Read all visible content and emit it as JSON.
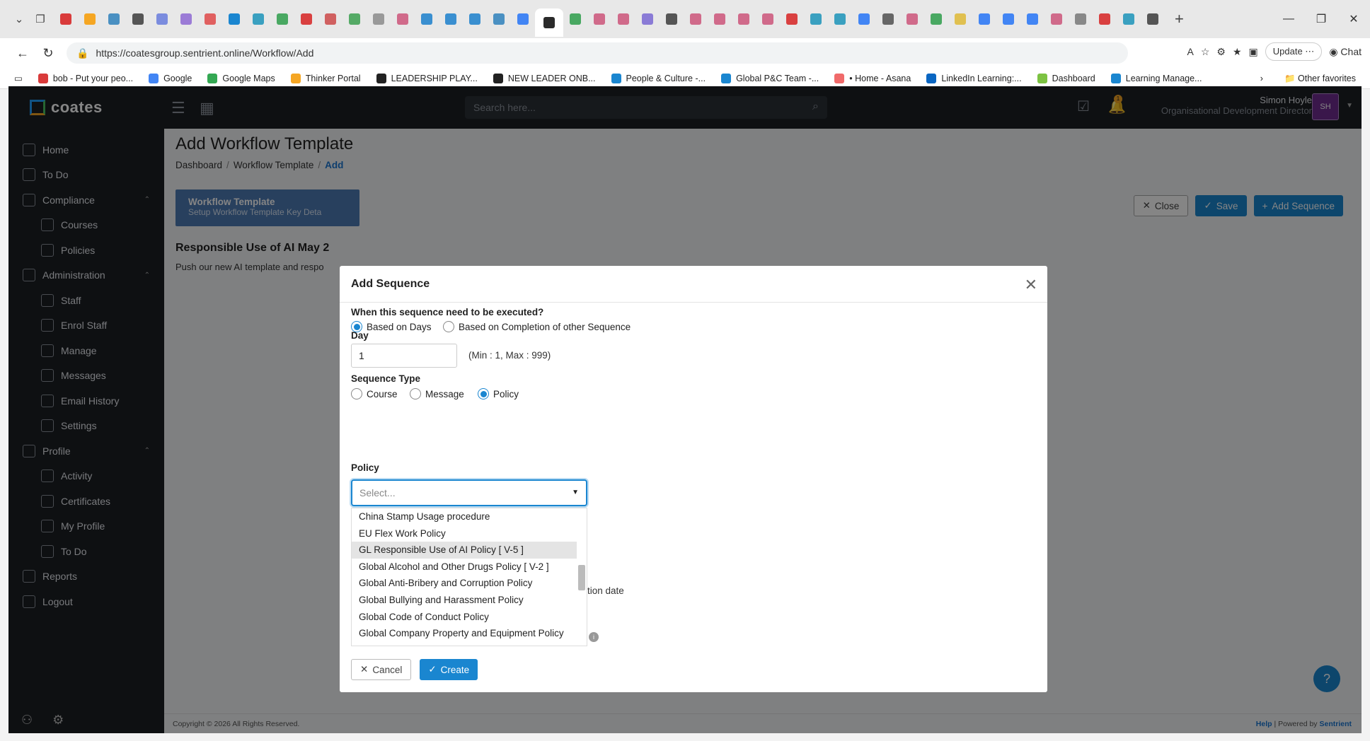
{
  "browser": {
    "url": "https://coatesgroup.sentrient.online/Workflow/Add",
    "update_label": "Update",
    "chat_label": "Chat",
    "bookmarks": [
      {
        "label": "bob - Put your peo...",
        "color": "#d93b3b"
      },
      {
        "label": "Google",
        "color": "#4285f4"
      },
      {
        "label": "Google Maps",
        "color": "#34a853"
      },
      {
        "label": "Thinker Portal",
        "color": "#f5a623"
      },
      {
        "label": "LEADERSHIP PLAY...",
        "color": "#222222"
      },
      {
        "label": "NEW LEADER ONB...",
        "color": "#222222"
      },
      {
        "label": "People & Culture -...",
        "color": "#1a86d0"
      },
      {
        "label": "Global P&C Team -...",
        "color": "#1a86d0"
      },
      {
        "label": "• Home - Asana",
        "color": "#f06a6a"
      },
      {
        "label": "LinkedIn Learning:...",
        "color": "#0a66c2"
      },
      {
        "label": "Dashboard",
        "color": "#7cc242"
      },
      {
        "label": "Learning Manage...",
        "color": "#1a86d0"
      }
    ],
    "other_favorites": "Other favorites"
  },
  "app": {
    "logo": "coates",
    "search_placeholder": "Search here...",
    "notif_count": "1",
    "user_name": "Simon Hoyle",
    "user_role": "Organisational Development Director",
    "user_initials": "SH"
  },
  "sidebar": {
    "items": [
      {
        "label": "Home",
        "type": "top"
      },
      {
        "label": "To Do",
        "type": "top"
      },
      {
        "label": "Compliance",
        "type": "group"
      },
      {
        "label": "Courses",
        "type": "sub"
      },
      {
        "label": "Policies",
        "type": "sub"
      },
      {
        "label": "Administration",
        "type": "group"
      },
      {
        "label": "Staff",
        "type": "sub"
      },
      {
        "label": "Enrol Staff",
        "type": "sub"
      },
      {
        "label": "Manage",
        "type": "sub"
      },
      {
        "label": "Messages",
        "type": "sub"
      },
      {
        "label": "Email History",
        "type": "sub"
      },
      {
        "label": "Settings",
        "type": "sub"
      },
      {
        "label": "Profile",
        "type": "group"
      },
      {
        "label": "Activity",
        "type": "sub"
      },
      {
        "label": "Certificates",
        "type": "sub"
      },
      {
        "label": "My Profile",
        "type": "sub"
      },
      {
        "label": "To Do",
        "type": "sub"
      },
      {
        "label": "Reports",
        "type": "top"
      },
      {
        "label": "Logout",
        "type": "top"
      }
    ]
  },
  "page": {
    "title": "Add Workflow Template",
    "breadcrumb": [
      "Dashboard",
      "Workflow Template",
      "Add"
    ],
    "card_title": "Workflow Template",
    "card_subtitle": "Setup Workflow Template Key Deta",
    "close_label": "Close",
    "save_label": "Save",
    "add_sequence_label": "Add Sequence",
    "template_name": "Responsible Use of AI May 2",
    "template_desc": "Push our new AI template and respo",
    "footer_left": "Copyright © 2026 All Rights Reserved.",
    "footer_help": "Help",
    "footer_powered": "Powered by",
    "footer_brand": "Sentrient"
  },
  "modal": {
    "title": "Add Sequence",
    "q_label": "When this sequence need to be executed?",
    "exec_options": [
      "Based on Days",
      "Based on Completion of other Sequence"
    ],
    "exec_selected": 0,
    "day_label": "Day",
    "day_value": "1",
    "day_hint": "(Min : 1, Max : 999)",
    "seq_type_label": "Sequence Type",
    "seq_types": [
      "Course",
      "Message",
      "Policy"
    ],
    "seq_type_selected": 2,
    "policy_label": "Policy",
    "policy_placeholder": "Select...",
    "policy_options": [
      "China Stamp Usage procedure",
      "EU Flex Work Policy",
      "GL Responsible Use of AI Policy [ V-5 ]",
      "Global Alcohol and Other Drugs Policy [ V-2 ]",
      "Global Anti-Bribery and Corruption Policy",
      "Global Bullying and Harassment Policy",
      "Global Code of Conduct Policy",
      "Global Company Property and Equipment Policy"
    ],
    "policy_highlighted": 2,
    "behind_text": "tion date",
    "cancel_label": "Cancel",
    "create_label": "Create"
  },
  "colors": {
    "accent": "#1a86d0",
    "sidebar_bg": "#1b1f24",
    "avatar_bg": "#6f2d91"
  }
}
